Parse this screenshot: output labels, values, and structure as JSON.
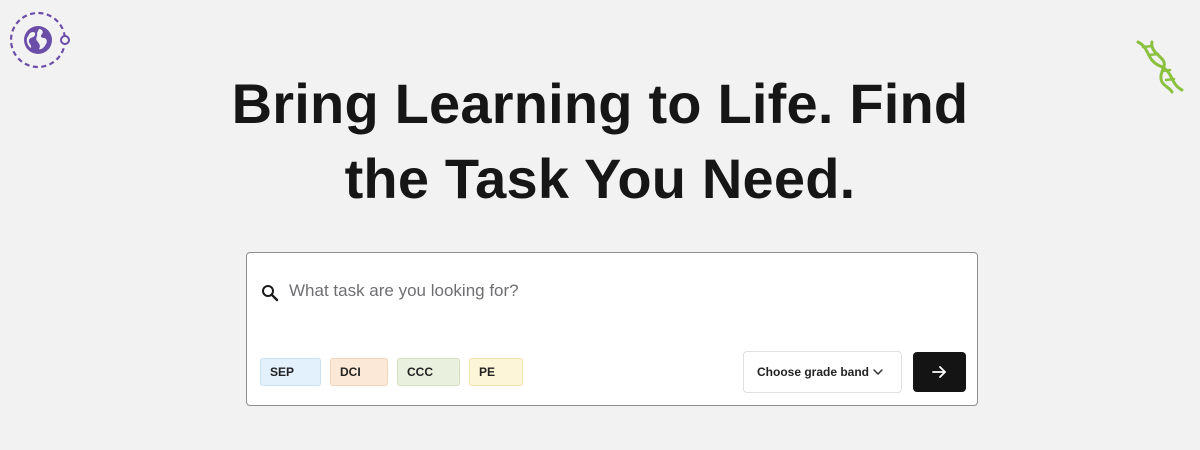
{
  "hero": {
    "headline_line1": "Bring Learning to Life. Find",
    "headline_line2": "the Task You Need."
  },
  "search": {
    "placeholder": "What task are you looking for?",
    "icon": "search-icon",
    "filters": [
      {
        "label": "SEP",
        "color": "#e3f1fc"
      },
      {
        "label": "DCI",
        "color": "#fce8d6"
      },
      {
        "label": "CCC",
        "color": "#e9f0dd"
      },
      {
        "label": "PE",
        "color": "#fdf5d7"
      }
    ],
    "grade_band": {
      "label": "Choose grade band",
      "icon": "chevron-down-icon"
    },
    "submit": {
      "icon": "arrow-right-icon",
      "color": "#141414"
    }
  },
  "decorations": {
    "left_icon": "globe-icon",
    "right_icon": "dna-icon",
    "accent_purple": "#6b4ea8",
    "accent_green": "#8ac13f"
  }
}
